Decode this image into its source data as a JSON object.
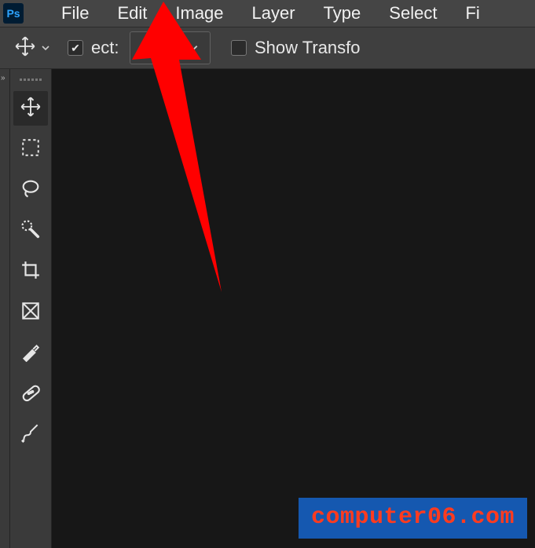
{
  "logo_text": "Ps",
  "menu": {
    "file": "File",
    "edit": "Edit",
    "image": "Image",
    "layer": "Layer",
    "type": "Type",
    "select": "Select",
    "fi": "Fi"
  },
  "options": {
    "auto_select_label": "ect:",
    "layer_dropdown": "Layer",
    "show_transform": "Show Transfo"
  },
  "watermark": "computer06.com"
}
